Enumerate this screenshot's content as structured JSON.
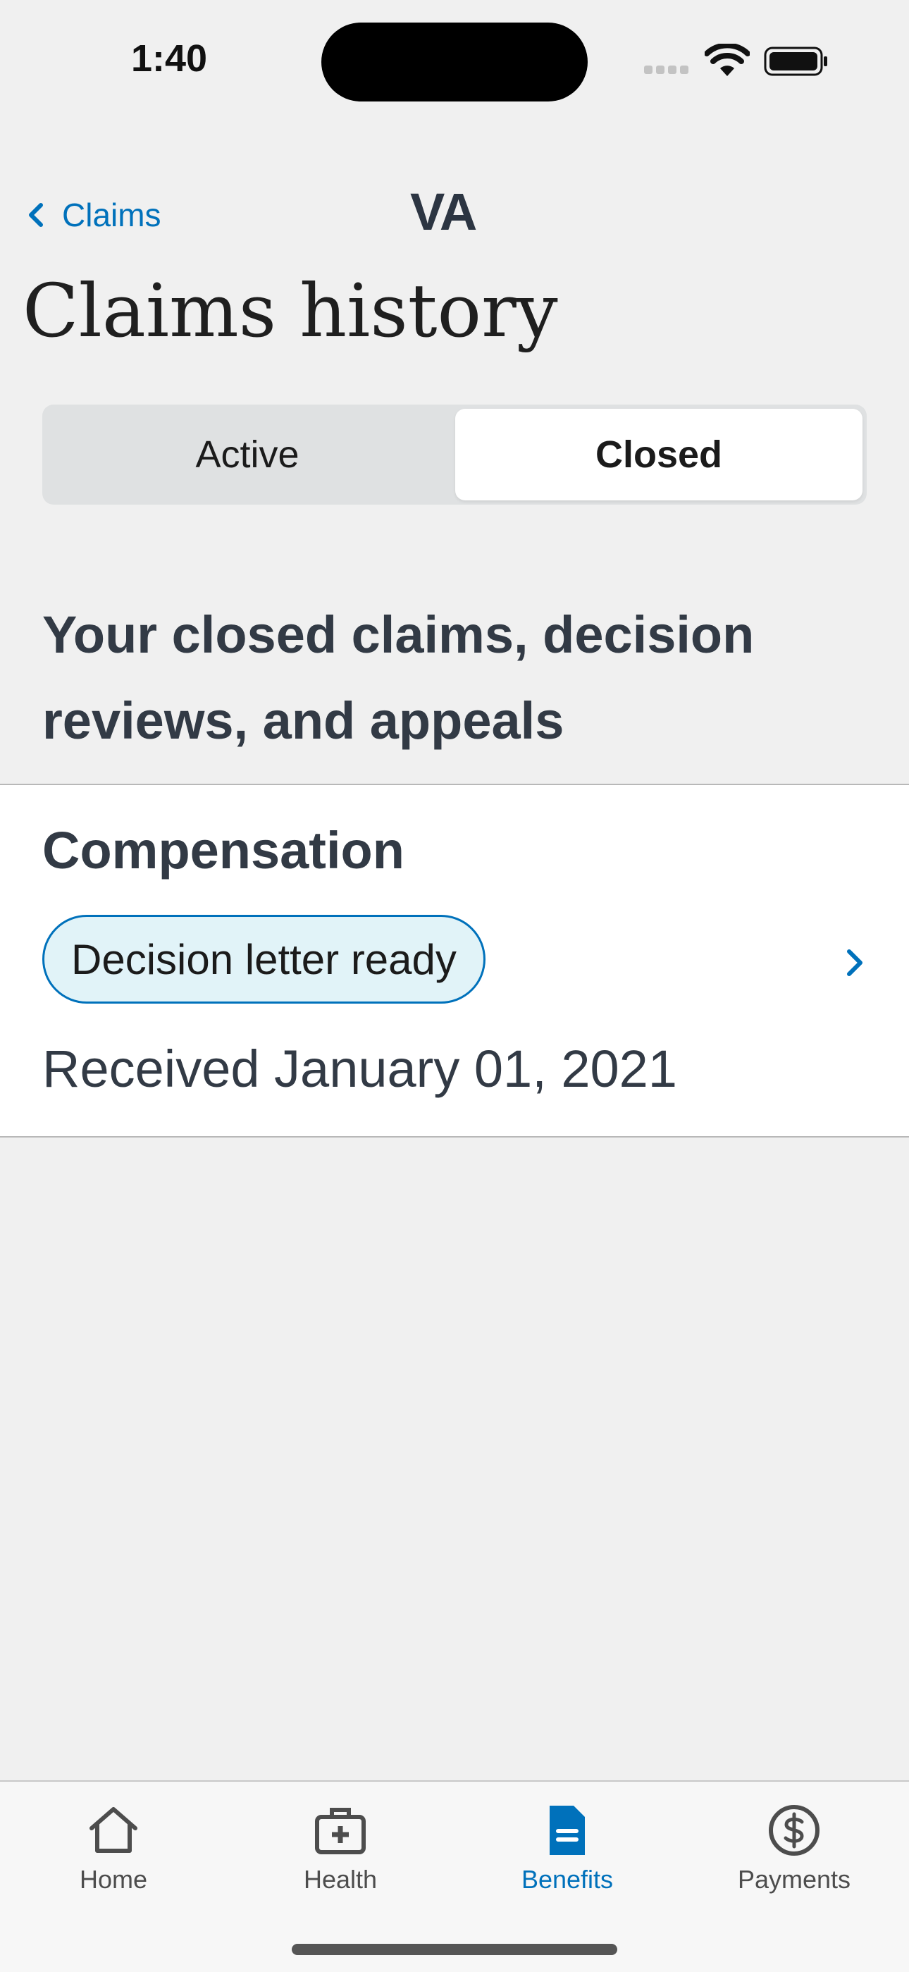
{
  "status_bar": {
    "time": "1:40"
  },
  "nav": {
    "back_label": "Claims",
    "logo_text": "VA"
  },
  "page": {
    "title": "Claims history"
  },
  "segmented_control": {
    "options": [
      "Active",
      "Closed"
    ],
    "selected": "Closed"
  },
  "section": {
    "heading": "Your closed claims, decision reviews, and appeals"
  },
  "claims": [
    {
      "title": "Compensation",
      "status_badge": "Decision letter ready",
      "received": "Received January 01, 2021"
    }
  ],
  "tab_bar": {
    "tabs": [
      {
        "label": "Home",
        "icon": "home-icon"
      },
      {
        "label": "Health",
        "icon": "medical-bag-icon"
      },
      {
        "label": "Benefits",
        "icon": "document-icon"
      },
      {
        "label": "Payments",
        "icon": "dollar-circle-icon"
      }
    ],
    "selected": "Benefits"
  },
  "colors": {
    "accent": "#0071bb",
    "text_dark": "#323a45",
    "background": "#f0f0f0",
    "badge_bg": "#e1f3f8"
  }
}
